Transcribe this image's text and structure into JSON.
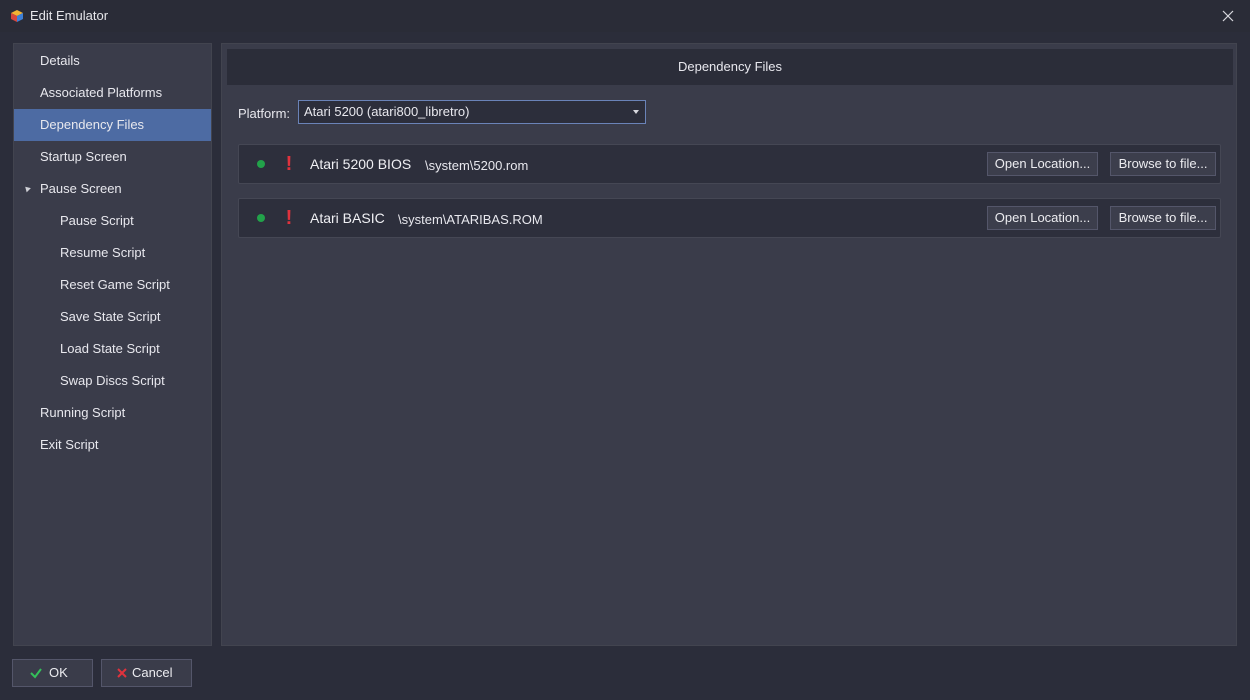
{
  "window": {
    "title": "Edit Emulator",
    "icon": "launchbox-cube-icon",
    "close_icon": "close-icon"
  },
  "sidebar": {
    "items": [
      {
        "label": "Details",
        "level": 1,
        "selected": false
      },
      {
        "label": "Associated Platforms",
        "level": 1,
        "selected": false
      },
      {
        "label": "Dependency Files",
        "level": 1,
        "selected": true
      },
      {
        "label": "Startup Screen",
        "level": 1,
        "selected": false
      },
      {
        "label": "Pause Screen",
        "level": 1,
        "selected": false,
        "expanded": true
      },
      {
        "label": "Pause Script",
        "level": 2,
        "selected": false
      },
      {
        "label": "Resume Script",
        "level": 2,
        "selected": false
      },
      {
        "label": "Reset Game Script",
        "level": 2,
        "selected": false
      },
      {
        "label": "Save State Script",
        "level": 2,
        "selected": false
      },
      {
        "label": "Load State Script",
        "level": 2,
        "selected": false
      },
      {
        "label": "Swap Discs Script",
        "level": 2,
        "selected": false
      },
      {
        "label": "Running Script",
        "level": 1,
        "selected": false
      },
      {
        "label": "Exit Script",
        "level": 1,
        "selected": false
      }
    ]
  },
  "main": {
    "header": "Dependency Files",
    "platform": {
      "label": "Platform:",
      "selected": "Atari 5200 (atari800_libretro)"
    },
    "dependencies": [
      {
        "name": "Atari 5200 BIOS",
        "path": "\\system\\5200.rom",
        "status_color": "#22a24a",
        "warning_icon": "exclamation-icon",
        "open_label": "Open Location...",
        "browse_label": "Browse to file..."
      },
      {
        "name": "Atari BASIC",
        "path": "\\system\\ATARIBAS.ROM",
        "status_color": "#22a24a",
        "warning_icon": "exclamation-icon",
        "open_label": "Open Location...",
        "browse_label": "Browse to file..."
      }
    ]
  },
  "footer": {
    "ok_label": "OK",
    "ok_icon": "checkmark-icon",
    "cancel_label": "Cancel",
    "cancel_icon": "x-mark-icon"
  },
  "colors": {
    "accent_selected": "#4d6ba3",
    "background": "#2b2d3a",
    "panel": "#3a3c4a",
    "warning": "#e0323d",
    "ok_green": "#22a24a"
  }
}
